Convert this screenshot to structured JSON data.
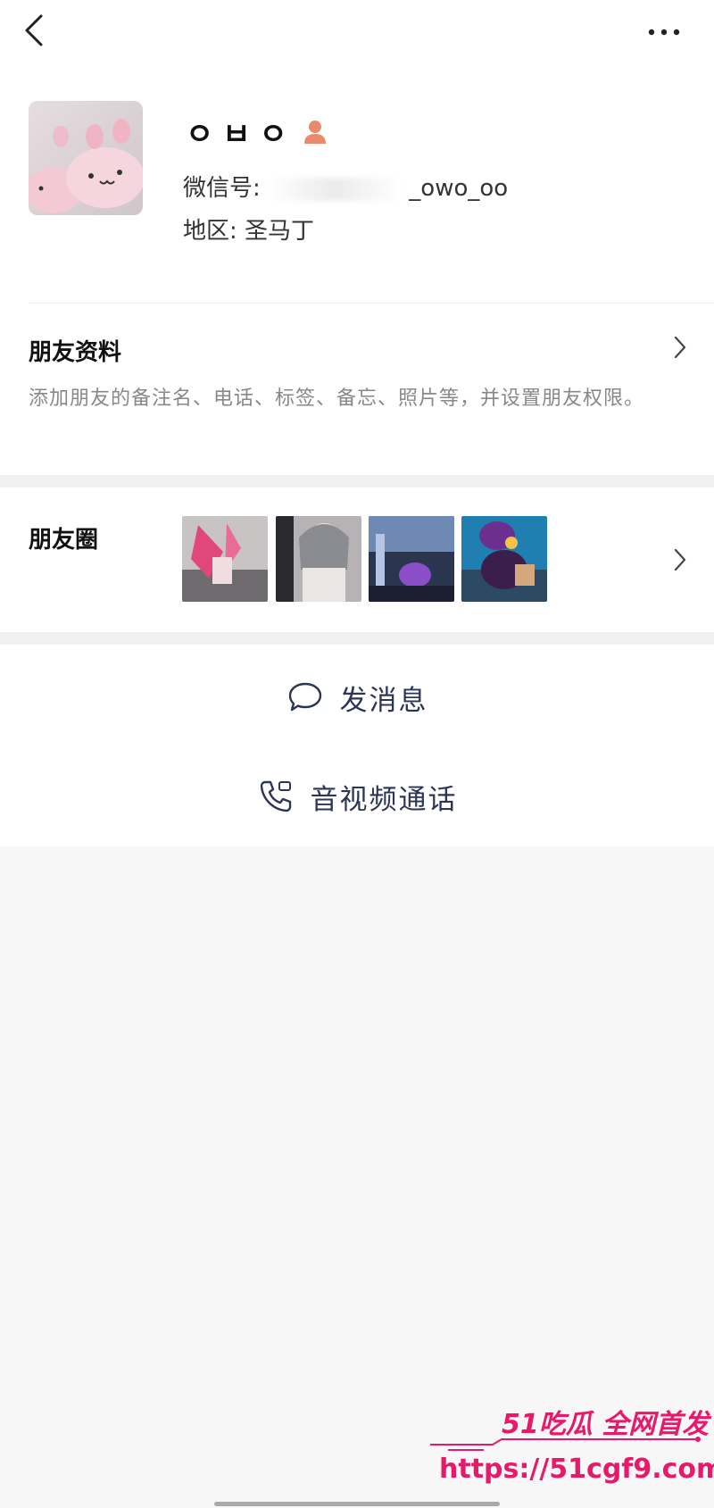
{
  "navbar": {
    "back_icon": "chevron-left-icon",
    "more_icon": "more-dots-icon"
  },
  "profile": {
    "nickname": "ㅇㅂㅇ",
    "gender_icon": "female-user-icon",
    "wechat_id_label": "微信号:",
    "wechat_id_visible": "_owo_oo",
    "region_label": "地区:",
    "region_value": "圣马丁"
  },
  "friend_profile": {
    "title": "朋友资料",
    "description": "添加朋友的备注名、电话、标签、备忘、照片等，并设置朋友权限。"
  },
  "moments": {
    "title": "朋友圈",
    "thumbnail_count": 4
  },
  "actions": {
    "message_label": "发消息",
    "message_icon": "chat-bubble-icon",
    "call_label": "音视频通话",
    "call_icon": "phone-icon"
  },
  "watermark": {
    "line1": "51吃瓜 全网首发",
    "line2": "https://51cgf9.com"
  },
  "colors": {
    "action_text": "#2a3557",
    "watermark": "#e8196b",
    "gender_icon": "#e98a6c"
  }
}
